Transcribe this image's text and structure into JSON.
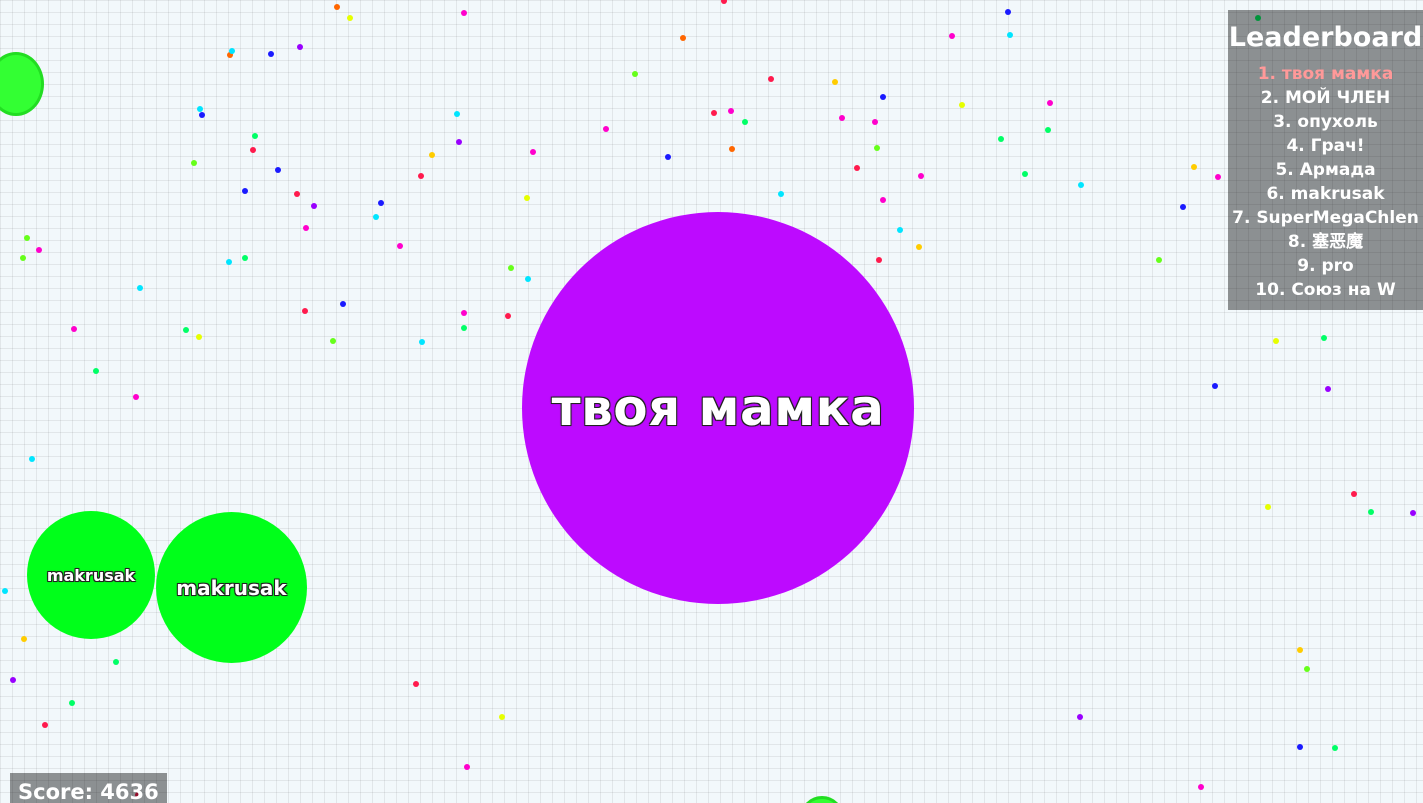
{
  "leaderboard": {
    "title": "Leaderboard",
    "entries": [
      "1. твоя мамка",
      "2. МОЙ ЧЛЕН",
      "3. опухоль",
      "4. Грач!",
      "5. Армада",
      "6. makrusak",
      "7. SuperMegaChlen",
      "8. 塞恶魔",
      "9. pro",
      "10. Союз на W"
    ],
    "highlight_color": "#ff9999"
  },
  "score": {
    "label": "Score: 4636"
  },
  "cells": {
    "main": {
      "name": "твоя мамка",
      "color": "#bd0aff"
    },
    "split_small": {
      "name": "makrusak",
      "color": "#00ff1a"
    },
    "split_large": {
      "name": "makrusak",
      "color": "#00ff1a"
    }
  },
  "virus_color": "#33ff33",
  "pellet_palette": [
    "#ff1a4d",
    "#ff00cc",
    "#00e5ff",
    "#1a1aff",
    "#66ff1a",
    "#ffcc00",
    "#ff6600",
    "#00ff66",
    "#9900ff",
    "#e6ff00"
  ]
}
